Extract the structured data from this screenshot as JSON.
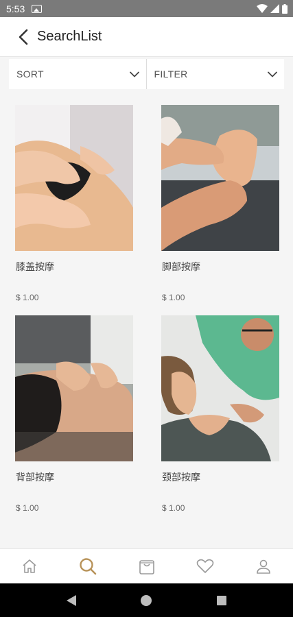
{
  "status": {
    "time": "5:53"
  },
  "header": {
    "title": "SearchList"
  },
  "toolbar": {
    "sort_label": "SORT",
    "filter_label": "FILTER"
  },
  "products": [
    {
      "name": "膝盖按摩",
      "price": "$ 1.00"
    },
    {
      "name": "脚部按摩",
      "price": "$ 1.00"
    },
    {
      "name": "背部按摩",
      "price": "$ 1.00"
    },
    {
      "name": "颈部按摩",
      "price": "$ 1.00"
    }
  ],
  "bottom_nav": [
    {
      "icon": "home-icon",
      "active": false
    },
    {
      "icon": "search-icon",
      "active": true
    },
    {
      "icon": "bag-icon",
      "active": false
    },
    {
      "icon": "heart-icon",
      "active": false
    },
    {
      "icon": "profile-icon",
      "active": false
    }
  ],
  "colors": {
    "accent": "#b8935a",
    "inactive": "#9a9a9a"
  }
}
